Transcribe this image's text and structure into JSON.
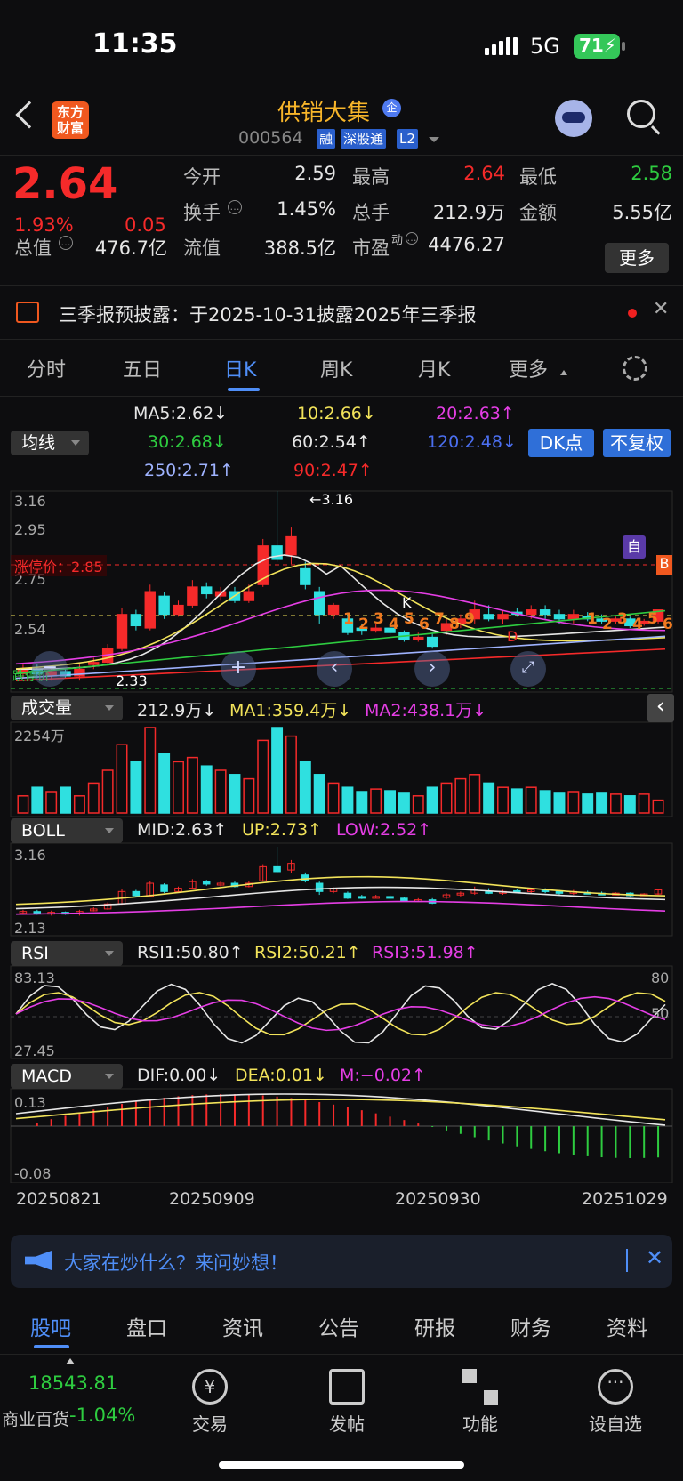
{
  "status": {
    "time": "11:35",
    "network": "5G",
    "battery": "71"
  },
  "header": {
    "title": "供销大集",
    "qi": "企",
    "logo": "东方\n财富",
    "code": "000564",
    "tags": [
      "融",
      "深股通",
      "L2"
    ]
  },
  "quote": {
    "price": "2.64",
    "pct": "1.93%",
    "change": "0.05",
    "open_l": "今开",
    "open": "2.59",
    "high_l": "最高",
    "high": "2.64",
    "low_l": "最低",
    "low": "2.58",
    "turnover_l": "换手",
    "turnover": "1.45%",
    "vol_l": "总手",
    "vol": "212.9万",
    "amount_l": "金额",
    "amount": "5.55亿",
    "mcap_l": "总值",
    "mcap": "476.7亿",
    "float_l": "流值",
    "float": "388.5亿",
    "pe_l": "市盈",
    "pe_sup": "动",
    "pe": "4476.27",
    "more": "更多"
  },
  "notice": {
    "text": "三季报预披露：于2025-10-31披露2025年三季报",
    "close": "✕"
  },
  "tabs": [
    "分时",
    "五日",
    "日K",
    "周K",
    "月K",
    "更多"
  ],
  "active_tab": "日K",
  "ma": {
    "selector": "均线",
    "ma5": "MA5:2.62↓",
    "ma10": "10:2.66↓",
    "ma20": "20:2.63↑",
    "ma30": "30:2.68↓",
    "ma60": "60:2.54↑",
    "ma120": "120:2.48↓",
    "ma250": "250:2.71↑",
    "ma90": "90:2.47↑",
    "dk": "DK点",
    "fq": "不复权"
  },
  "kline": {
    "y_top": "3.16",
    "y2": "2.95",
    "y3": "2.75",
    "y4": "2.54",
    "limit_label": "涨停价：2.85",
    "limit_right": "B",
    "max_label": "←3.16",
    "min_label": "2.33",
    "zi": "自",
    "low_limit": "跌停价",
    "k": "K",
    "d": "D",
    "count_left": [
      "1",
      "2",
      "3",
      "4",
      "5",
      "6",
      "7",
      "8",
      "9"
    ],
    "count_right": [
      "1",
      "2",
      "3",
      "4",
      "5",
      "6"
    ]
  },
  "volume": {
    "selector": "成交量",
    "v": "212.9万↓",
    "ma1": "MA1:359.4万↓",
    "ma2": "MA2:438.1万↓",
    "max": "2254万",
    "chevron": "‹"
  },
  "boll": {
    "selector": "BOLL",
    "mid": "MID:2.63↑",
    "up": "UP:2.73↑",
    "low": "LOW:2.52↑",
    "top": "3.16",
    "bottom": "2.13"
  },
  "rsi": {
    "selector": "RSI",
    "r1": "RSI1:50.80↑",
    "r2": "RSI2:50.21↑",
    "r3": "RSI3:51.98↑",
    "top": "83.13",
    "bottom": "27.45",
    "r80": "80",
    "r50": "50"
  },
  "macd": {
    "selector": "MACD",
    "dif": "DIF:0.00↓",
    "dea": "DEA:0.01↓",
    "m": "M:−0.02↑",
    "top": "0.13",
    "bottom": "-0.08"
  },
  "dates": [
    "20250821",
    "20250909",
    "20250930",
    "20251029"
  ],
  "ask": {
    "text": "大家在炒什么？来问妙想！",
    "close": "✕"
  },
  "bottom_tabs": [
    "股吧",
    "盘口",
    "资讯",
    "公告",
    "研报",
    "财务",
    "资料"
  ],
  "footer": {
    "index_value": "18543.81",
    "index_name": "商业百货",
    "index_pct": "-1.04%",
    "trade": "交易",
    "post": "发帖",
    "func": "功能",
    "watch": "设自选",
    "trade_icon": "¥"
  },
  "colors": {
    "up": "#f52a2a",
    "down": "#2fe0e0",
    "accent": "#4f8ef7",
    "yellow": "#f2e35a",
    "magenta": "#e53ee5",
    "green": "#2ecc40"
  }
}
